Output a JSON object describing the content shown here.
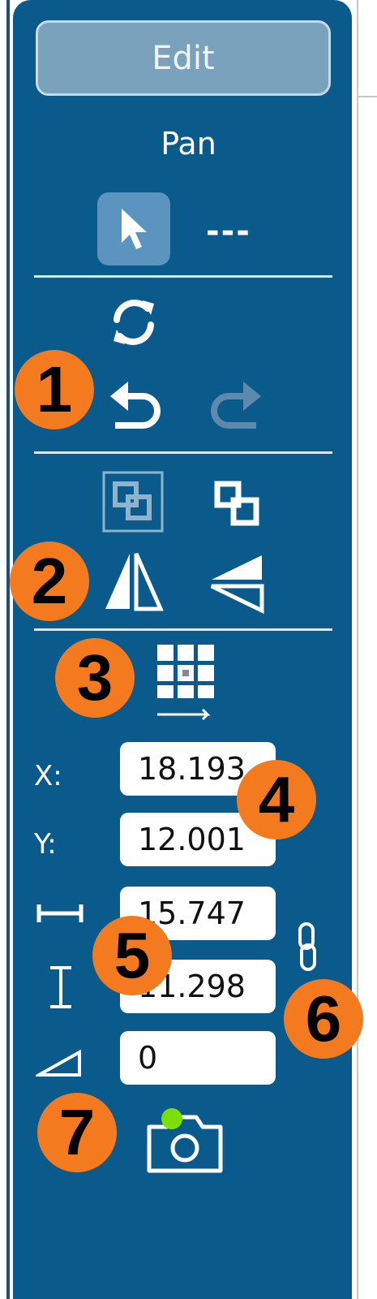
{
  "toolbar": {
    "edit_label": "Edit",
    "pan_label": "Pan",
    "select_icon": "arrow-pointer-icon",
    "line_style_label": "---",
    "refresh_icon": "refresh-icon",
    "undo_icon": "undo-icon",
    "redo_icon": "redo-icon",
    "bring_to_front_icon": "bring-to-front-icon",
    "send_to_back_icon": "send-to-back-icon",
    "flip_horizontal_icon": "flip-horizontal-icon",
    "flip_vertical_icon": "flip-vertical-icon",
    "alignment_grid_icon": "alignment-grid-icon",
    "link_icon": "chain-link-icon",
    "camera_icon": "camera-icon"
  },
  "fields": {
    "x_label": "X:",
    "x_value": "18.193",
    "y_label": "Y:",
    "y_value": "12.001",
    "width_value": "15.747",
    "height_value": "11.298",
    "angle_value": "0"
  },
  "badges": [
    "1",
    "2",
    "3",
    "4",
    "5",
    "6",
    "7"
  ],
  "colors": {
    "panel": "#0b5a8c",
    "badge": "#f47a1f",
    "camera_status": "#7be000"
  }
}
